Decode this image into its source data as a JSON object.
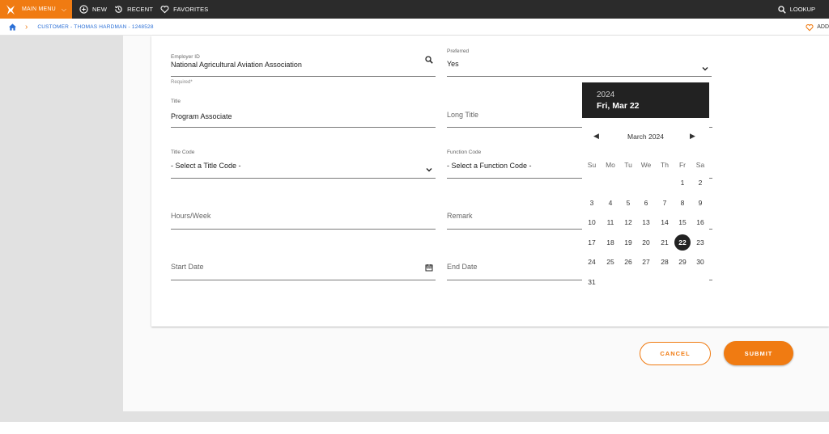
{
  "topbar": {
    "main_menu": "MAIN MENU",
    "new": "NEW",
    "recent": "RECENT",
    "favorites": "FAVORITES",
    "lookup": "LOOKUP"
  },
  "breadcrumb": {
    "crumb": "CUSTOMER - THOMAS HARDMAN - 1248528",
    "add_favorite": "ADD"
  },
  "form": {
    "employer": {
      "label": "Employer ID",
      "value": "National Agricultural Aviation Association",
      "helper": "Required*"
    },
    "preferred": {
      "label": "Preferred",
      "value": "Yes"
    },
    "title": {
      "label": "Title",
      "value": "Program Associate"
    },
    "long_title": {
      "placeholder": "Long Title"
    },
    "title_code": {
      "label": "Title Code",
      "value": "- Select a Title Code -"
    },
    "function_code": {
      "label": "Function Code",
      "value": "- Select a Function Code -"
    },
    "hours_week": {
      "placeholder": "Hours/Week"
    },
    "remark": {
      "placeholder": "Remark"
    },
    "start_date": {
      "placeholder": "Start Date"
    },
    "end_date": {
      "placeholder": "End Date"
    }
  },
  "datepicker": {
    "year": "2024",
    "selected_label": "Fri, Mar 22",
    "month_title": "March 2024",
    "weekdays": [
      "Su",
      "Mo",
      "Tu",
      "We",
      "Th",
      "Fr",
      "Sa"
    ],
    "days": [
      "1",
      "2",
      "3",
      "4",
      "5",
      "6",
      "7",
      "8",
      "9",
      "10",
      "11",
      "12",
      "13",
      "14",
      "15",
      "16",
      "17",
      "18",
      "19",
      "20",
      "21",
      "22",
      "23",
      "24",
      "25",
      "26",
      "27",
      "28",
      "29",
      "30",
      "31"
    ],
    "first_weekday_index": 5,
    "selected_day": "22"
  },
  "actions": {
    "cancel": "CANCEL",
    "submit": "SUBMIT"
  },
  "colors": {
    "accent": "#f07b12",
    "topbar": "#2b2b2b",
    "link": "#2a6fd6"
  }
}
